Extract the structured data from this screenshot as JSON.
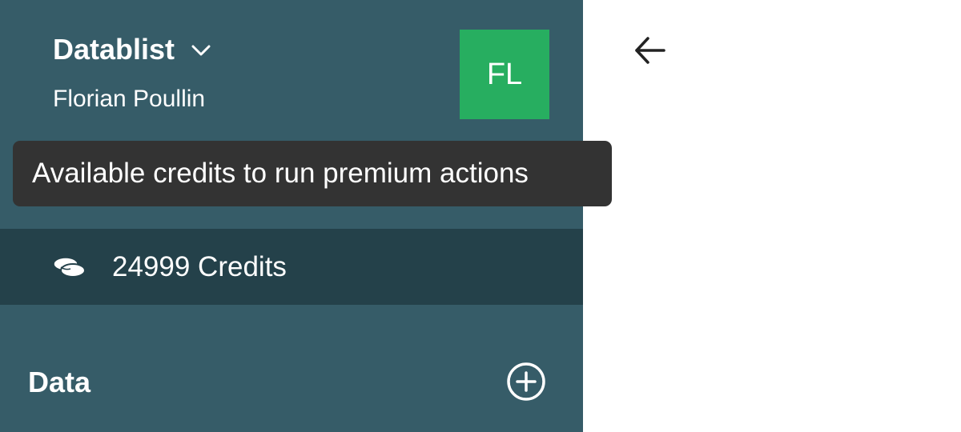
{
  "workspace": {
    "name": "Datablist",
    "user": "Florian Poullin",
    "avatar_initials": "FL",
    "avatar_color": "#27ae60"
  },
  "tooltip": {
    "text": "Available credits to run premium actions"
  },
  "credits": {
    "label": "24999 Credits",
    "icon": "coins-icon"
  },
  "data_section": {
    "title": "Data",
    "add_icon": "plus-circle-icon"
  },
  "header": {
    "back_icon": "arrow-left-icon"
  },
  "colors": {
    "sidebar_bg": "#365c68",
    "sidebar_active_bg": "#24414a",
    "tooltip_bg": "#333333",
    "accent": "#27ae60"
  }
}
